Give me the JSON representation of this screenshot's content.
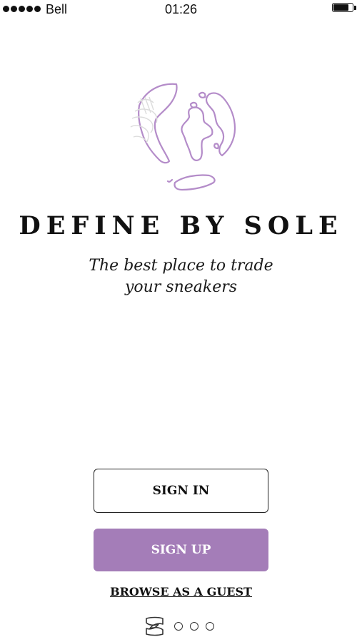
{
  "status_bar": {
    "carrier": "Bell",
    "time": "01:26"
  },
  "brand": {
    "title": "DEFINE BY SOLE",
    "tagline_line1": "The best place to trade",
    "tagline_line2": "your sneakers"
  },
  "actions": {
    "sign_in": "SIGN IN",
    "sign_up": "SIGN UP",
    "browse_guest": "BROWSE AS A GUEST"
  },
  "pager": {
    "total_pages": 4,
    "current_page": 1
  },
  "colors": {
    "accent": "#a47db8",
    "text": "#111111",
    "logo_stroke": "#b48cc9"
  },
  "icons": {
    "logo": "globe-sneaker-icon",
    "page_mark": "sole-logo-icon"
  }
}
